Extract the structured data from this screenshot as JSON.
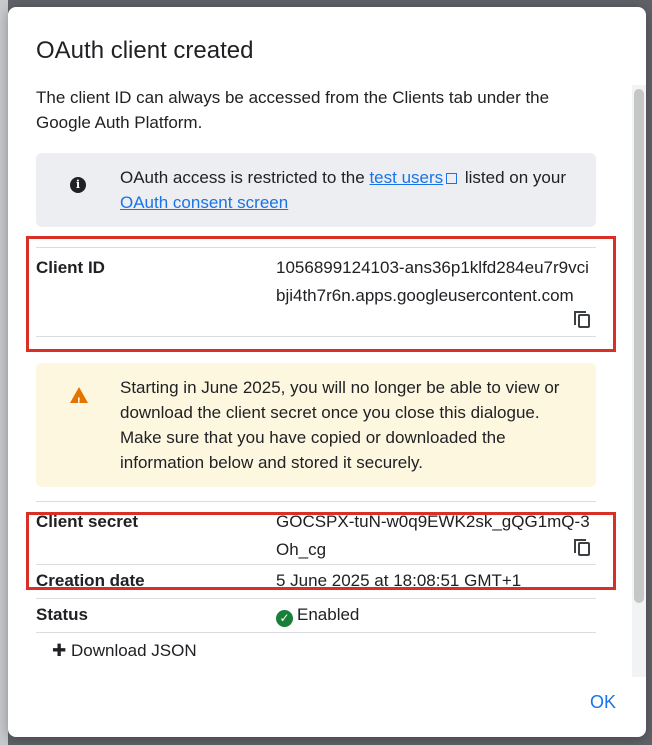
{
  "dialog": {
    "title": "OAuth client created",
    "intro": "The client ID can always be accessed from the Clients tab under the Google Auth Platform.",
    "info_banner": {
      "icon": "info-icon",
      "text_before": "OAuth access is restricted to the ",
      "link1": "test users",
      "text_middle": " listed on your ",
      "link2": "OAuth consent screen"
    },
    "client_id": {
      "label": "Client ID",
      "value": "1056899124103-ans36p1klfd284eu7r9vcibji4th7r6n.apps.googleusercontent.com"
    },
    "warning_banner": {
      "icon": "warning-icon",
      "text": "Starting in June 2025, you will no longer be able to view or download the client secret once you close this dialogue. Make sure that you have copied or downloaded the information below and stored it securely."
    },
    "client_secret": {
      "label": "Client secret",
      "value": "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"
    },
    "creation_date": {
      "label": "Creation date",
      "value": "5 June 2025 at 18:08:51 GMT+1"
    },
    "status": {
      "label": "Status",
      "value": "Enabled"
    },
    "download_label": "Download JSON",
    "ok_label": "OK"
  },
  "colors": {
    "accent": "#1a73e8",
    "highlight": "#d93025",
    "warning": "#e37400",
    "success": "#188038"
  }
}
